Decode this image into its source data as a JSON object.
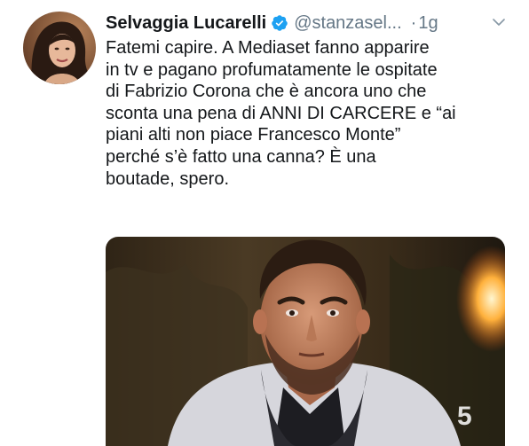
{
  "author": {
    "display_name": "Selvaggia Lucarelli",
    "handle": "@stanzasel...",
    "verified_icon": "verified-badge-icon",
    "avatar_icon": "profile-photo"
  },
  "meta": {
    "separator": "·",
    "time": "1g",
    "menu_icon": "chevron-down-icon"
  },
  "tweet": {
    "lines": [
      "Fatemi capire. A Mediaset fanno apparire",
      "in tv e pagano profumatamente le ospitate",
      "di Fabrizio Corona che è ancora uno che",
      "sconta una pena di ANNI DI CARCERE e “ai",
      "piani alti non piace Francesco Monte”",
      "perché s’è fatto una canna?  È una",
      "boutade, spero."
    ]
  },
  "media": {
    "type": "image",
    "watermark": "5"
  },
  "colors": {
    "text": "#14171a",
    "muted": "#657786",
    "verified": "#1da1f2"
  }
}
